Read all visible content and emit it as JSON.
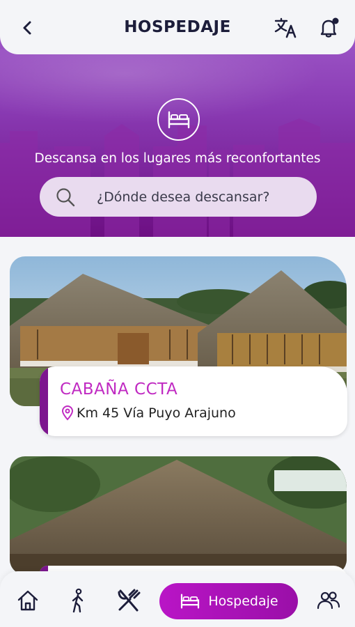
{
  "header": {
    "title": "HOSPEDAJE",
    "back_icon": "chevron-left-icon",
    "translate_icon": "translate-icon",
    "notification_icon": "bell-icon"
  },
  "hero": {
    "icon": "bed-icon",
    "tagline": "Descansa en los lugares más reconfortantes",
    "search_placeholder": "¿Dónde desea descansar?"
  },
  "listings": [
    {
      "name": "CABAÑA CCTA",
      "location": "Km 45 Vía Puyo Arajuno"
    }
  ],
  "bottom_nav": {
    "items": [
      {
        "icon": "home-icon"
      },
      {
        "icon": "walking-icon"
      },
      {
        "icon": "utensils-icon"
      },
      {
        "icon": "bed-icon",
        "label": "Hospedaje",
        "active": true
      },
      {
        "icon": "people-icon"
      }
    ]
  },
  "colors": {
    "accent": "#b915c6",
    "title_accent": "#c02ac2",
    "hero_top": "#a563cf",
    "hero_bottom": "#6d0f83"
  }
}
